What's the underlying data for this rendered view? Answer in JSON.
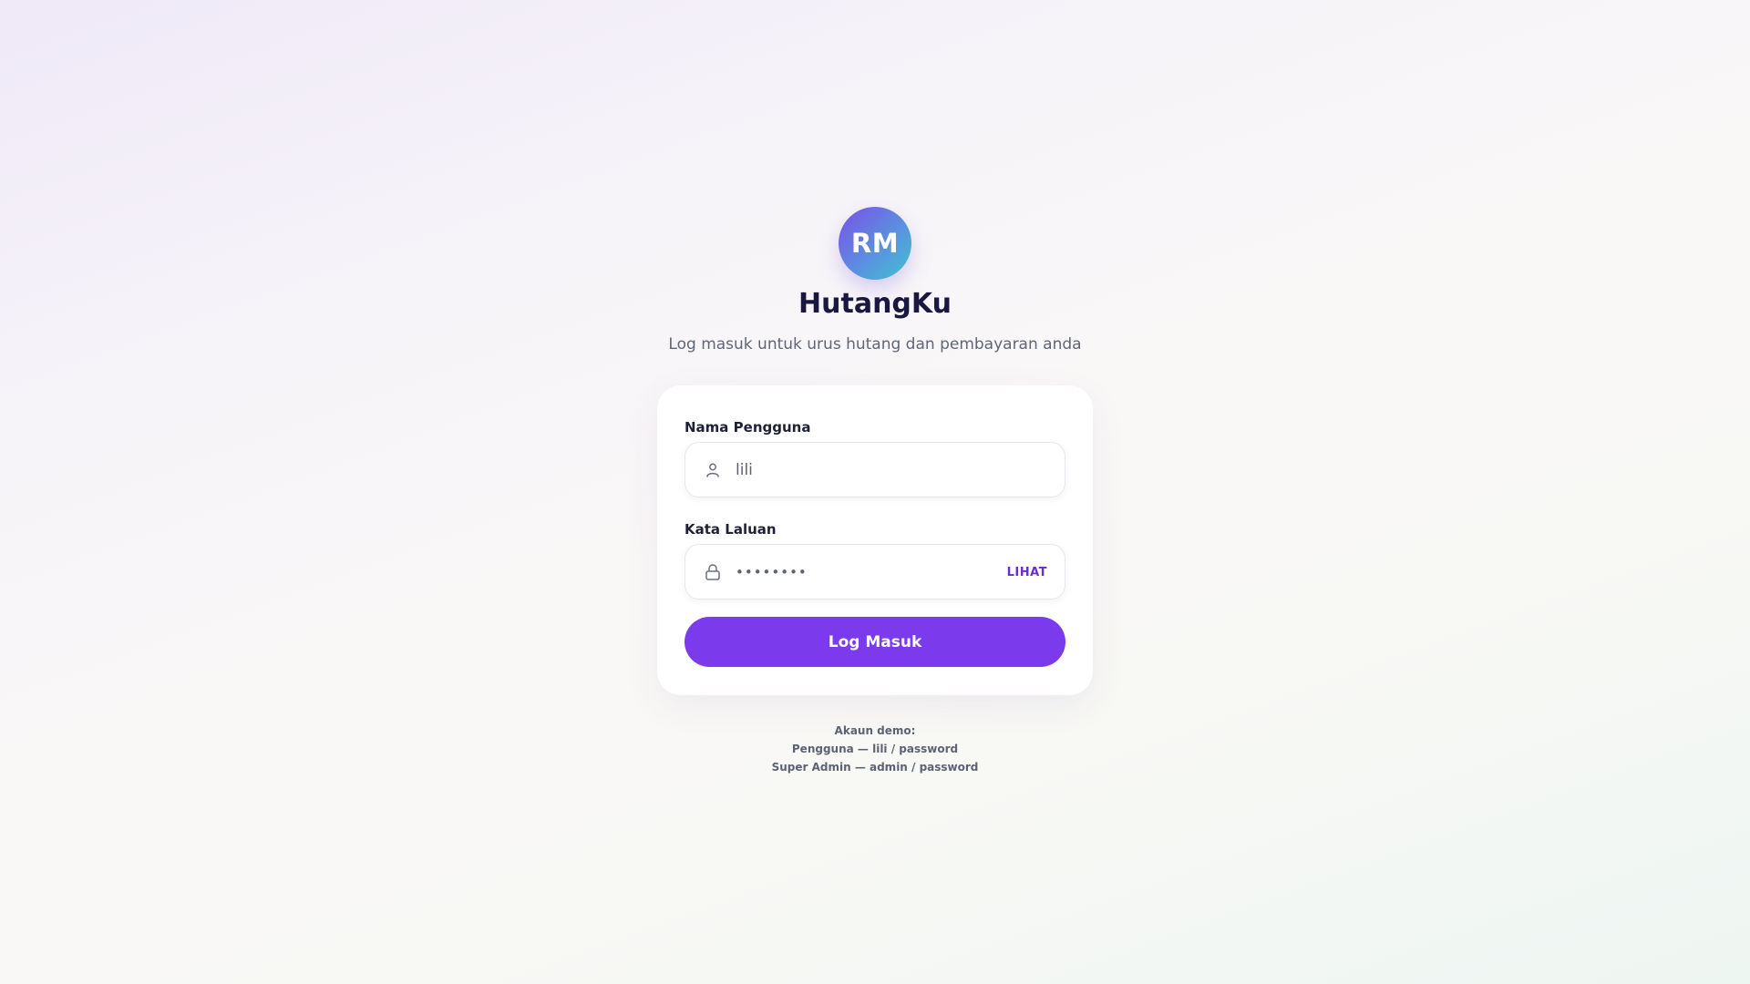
{
  "brand": {
    "logo_text": "RM",
    "app_name": "HutangKu",
    "subtitle": "Log masuk untuk urus hutang dan pembayaran anda"
  },
  "form": {
    "username": {
      "label": "Nama Pengguna",
      "value": "lili",
      "icon": "user-icon"
    },
    "password": {
      "label": "Kata Laluan",
      "masked_value": "••••••••",
      "icon": "lock-icon",
      "toggle_label": "LIHAT"
    },
    "submit_label": "Log Masuk"
  },
  "demo_accounts": {
    "heading": "Akaun demo:",
    "lines": [
      "Pengguna — lili / password",
      "Super Admin — admin / password"
    ]
  },
  "colors": {
    "accent": "#7c3aed",
    "title": "#1a1840",
    "muted": "#5f6677"
  }
}
